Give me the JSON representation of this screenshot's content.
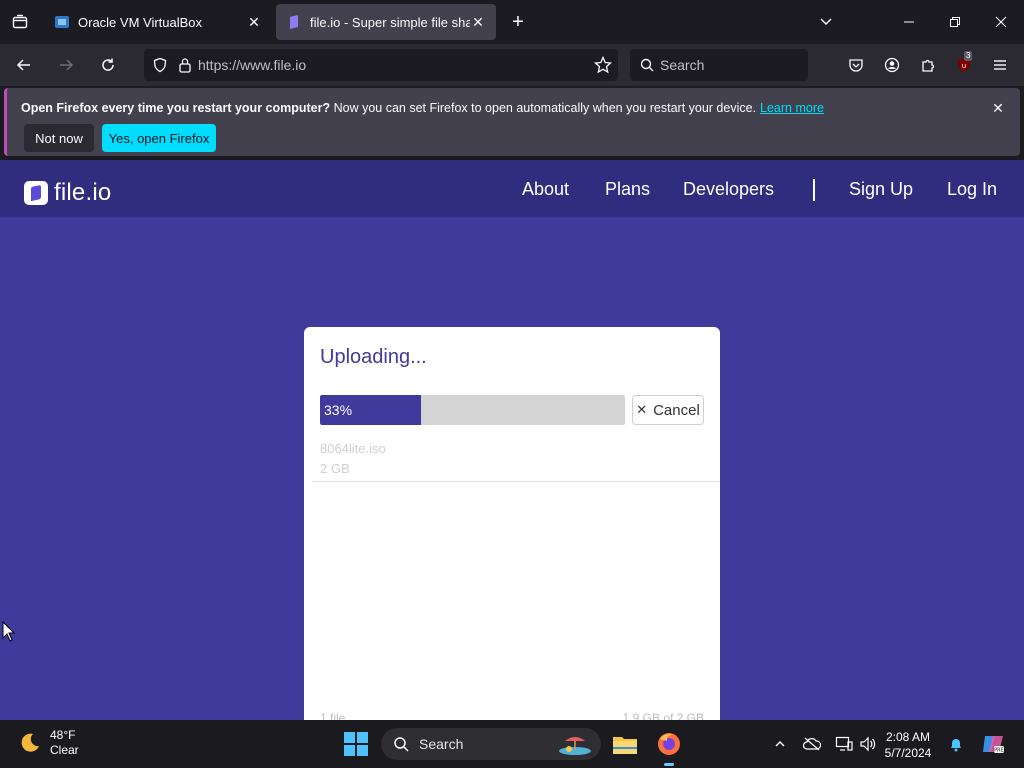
{
  "browser": {
    "tabs": [
      {
        "title": "Oracle VM VirtualBox",
        "active": false
      },
      {
        "title": "file.io - Super simple file sharing",
        "active": true
      }
    ],
    "url": "https://www.file.io",
    "search_placeholder": "Search",
    "extension_badge": "3"
  },
  "notification": {
    "bold": "Open Firefox every time you restart your computer?",
    "text": " Now you can set Firefox to open automatically when you restart your device.",
    "learn_more": "Learn more",
    "not_now": "Not now",
    "yes": "Yes, open Firefox"
  },
  "site": {
    "logo": "file.io",
    "nav": [
      "About",
      "Plans",
      "Developers",
      "Sign Up",
      "Log In"
    ]
  },
  "upload": {
    "title": "Uploading...",
    "progress": 33,
    "progress_label": "33%",
    "cancel": "Cancel",
    "file_name": "8064lite.iso",
    "file_size": "2 GB",
    "footer_left": "1 file",
    "footer_right": "1.9 GB of 2 GB"
  },
  "taskbar": {
    "weather_temp": "48°F",
    "weather_cond": "Clear",
    "search": "Search",
    "time": "2:08 AM",
    "date": "5/7/2024"
  },
  "colors": {
    "page_bg": "#3f3a9c",
    "header_bg": "#302c7e",
    "progress_fill": "#3f3a9c",
    "accent_button": "#00ddff"
  }
}
